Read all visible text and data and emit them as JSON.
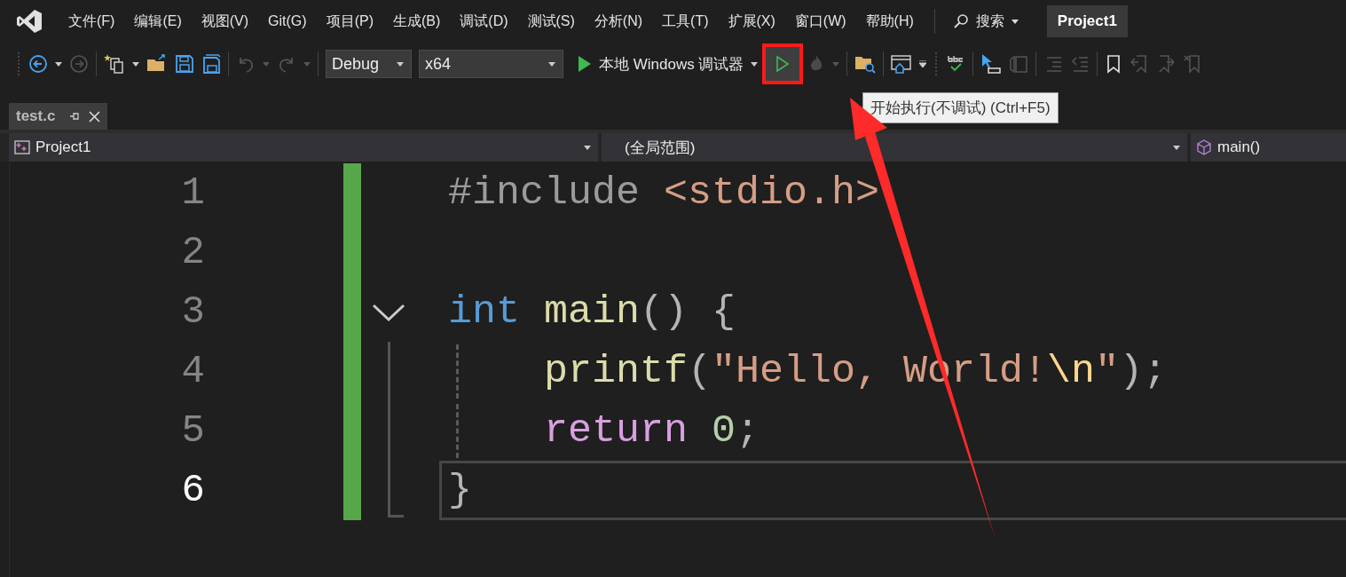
{
  "menu": [
    {
      "label": "文件(F)"
    },
    {
      "label": "编辑(E)"
    },
    {
      "label": "视图(V)"
    },
    {
      "label": "Git(G)"
    },
    {
      "label": "项目(P)"
    },
    {
      "label": "生成(B)"
    },
    {
      "label": "调试(D)"
    },
    {
      "label": "测试(S)"
    },
    {
      "label": "分析(N)"
    },
    {
      "label": "工具(T)"
    },
    {
      "label": "扩展(X)"
    },
    {
      "label": "窗口(W)"
    },
    {
      "label": "帮助(H)"
    }
  ],
  "search": {
    "label": "搜索"
  },
  "project_badge": "Project1",
  "toolbar": {
    "configuration": "Debug",
    "platform": "x64",
    "debugger": "本地 Windows 调试器",
    "run_highlighted": true,
    "tooltip": "开始执行(不调试) (Ctrl+F5)"
  },
  "tabs": [
    {
      "label": "test.c",
      "selected": true
    }
  ],
  "navigation": {
    "project": "Project1",
    "scope": "(全局范围)",
    "member": "main()"
  },
  "code": {
    "lines": [
      {
        "number": "1",
        "current": false,
        "changed": true,
        "collapsible": false,
        "in_block": false,
        "block_end": false,
        "guide": false,
        "tokens": [
          {
            "kind": "directive",
            "text": "#include "
          },
          {
            "kind": "string",
            "text": "<stdio.h>"
          }
        ]
      },
      {
        "number": "2",
        "current": false,
        "changed": true,
        "collapsible": false,
        "in_block": false,
        "block_end": false,
        "guide": false
      },
      {
        "number": "3",
        "current": false,
        "changed": true,
        "collapsible": true,
        "in_block": false,
        "block_end": false,
        "guide": false,
        "tokens": [
          {
            "kind": "keyword",
            "text": "int "
          },
          {
            "kind": "function",
            "text": "main"
          },
          {
            "kind": "punct",
            "text": "() {"
          }
        ]
      },
      {
        "number": "4",
        "current": false,
        "changed": true,
        "collapsible": false,
        "in_block": true,
        "block_end": false,
        "guide": true,
        "tokens": [
          {
            "kind": "function",
            "text": "printf"
          },
          {
            "kind": "punct",
            "text": "("
          },
          {
            "kind": "string",
            "text": "\"Hello, World!"
          },
          {
            "kind": "escape",
            "text": "\\n"
          },
          {
            "kind": "string",
            "text": "\""
          },
          {
            "kind": "punct",
            "text": ");"
          }
        ]
      },
      {
        "number": "5",
        "current": false,
        "changed": true,
        "collapsible": false,
        "in_block": true,
        "block_end": false,
        "guide": true,
        "tokens": [
          {
            "kind": "control",
            "text": "return "
          },
          {
            "kind": "number",
            "text": "0"
          },
          {
            "kind": "punct",
            "text": ";"
          }
        ]
      },
      {
        "number": "6",
        "current": true,
        "changed": true,
        "collapsible": false,
        "in_block": false,
        "block_end": true,
        "guide": false,
        "tokens": [
          {
            "kind": "punct",
            "text": "}"
          }
        ]
      }
    ]
  }
}
